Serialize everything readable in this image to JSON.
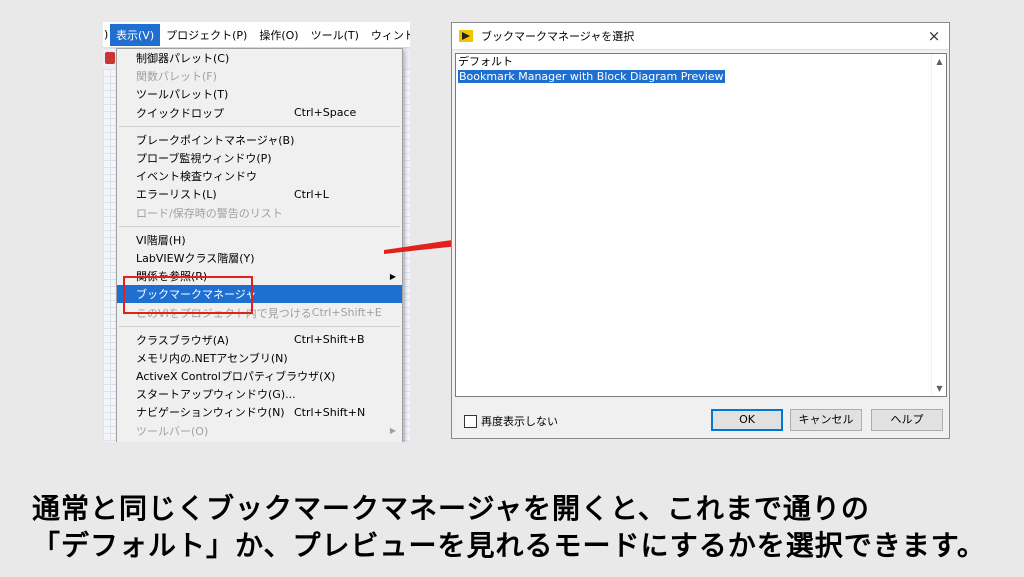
{
  "menubar": {
    "items": [
      "表示(V)",
      "プロジェクト(P)",
      "操作(O)",
      "ツール(T)",
      "ウィンドウ(W)"
    ]
  },
  "view_menu": {
    "group1": [
      {
        "label": "制御器パレット(C)",
        "shortcut": "",
        "disabled": false
      },
      {
        "label": "関数パレット(F)",
        "shortcut": "",
        "disabled": true
      },
      {
        "label": "ツールパレット(T)",
        "shortcut": "",
        "disabled": false
      },
      {
        "label": "クイックドロップ",
        "shortcut": "Ctrl+Space",
        "disabled": false
      }
    ],
    "group2": [
      {
        "label": "ブレークポイントマネージャ(B)",
        "shortcut": "",
        "disabled": false
      },
      {
        "label": "プローブ監視ウィンドウ(P)",
        "shortcut": "",
        "disabled": false
      },
      {
        "label": "イベント検査ウィンドウ",
        "shortcut": "",
        "disabled": false
      },
      {
        "label": "エラーリスト(L)",
        "shortcut": "Ctrl+L",
        "disabled": false
      },
      {
        "label": "ロード/保存時の警告のリスト",
        "shortcut": "",
        "disabled": true
      }
    ],
    "group3": [
      {
        "label": "VI階層(H)",
        "shortcut": "",
        "disabled": false
      },
      {
        "label": "LabVIEWクラス階層(Y)",
        "shortcut": "",
        "disabled": false
      },
      {
        "label": "関係を参照(R)",
        "shortcut": "",
        "disabled": false
      },
      {
        "label": "ブックマークマネージャ",
        "shortcut": "",
        "disabled": false
      },
      {
        "label": "このVIをプロジェクト内で見つける",
        "shortcut": "Ctrl+Shift+E",
        "disabled": true
      }
    ],
    "group4": [
      {
        "label": "クラスブラウザ(A)",
        "shortcut": "Ctrl+Shift+B",
        "disabled": false
      },
      {
        "label": "メモリ内の.NETアセンブリ(N)",
        "shortcut": "",
        "disabled": false
      },
      {
        "label": "ActiveX Controlプロパティブラウザ(X)",
        "shortcut": "",
        "disabled": false
      },
      {
        "label": "スタートアップウィンドウ(G)...",
        "shortcut": "",
        "disabled": false
      },
      {
        "label": "ナビゲーションウィンドウ(N)",
        "shortcut": "Ctrl+Shift+N",
        "disabled": false
      },
      {
        "label": "ツールバー(O)",
        "shortcut": "",
        "disabled": true
      }
    ]
  },
  "dialog": {
    "title": "ブックマークマネージャを選択",
    "close": "×",
    "list": [
      "デフォルト",
      "Bookmark Manager with Block Diagram Preview"
    ],
    "checkbox_label": "再度表示しない",
    "ok": "OK",
    "cancel": "キャンセル",
    "help": "ヘルプ"
  },
  "caption": {
    "line1": "通常と同じくブックマークマネージャを開くと、これまで通りの",
    "line2": "「デフォルト」か、プレビューを見れるモードにするかを選択できます。"
  },
  "colors": {
    "accent": "#1f6fd1",
    "highlight_red": "#e3211c",
    "arrow_red": "#e3211c"
  }
}
